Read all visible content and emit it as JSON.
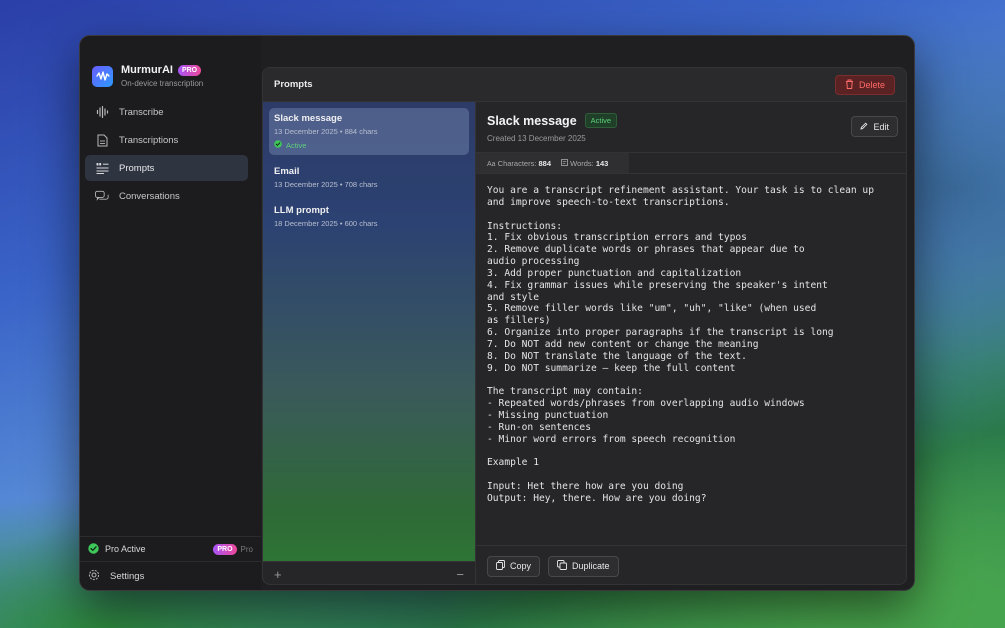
{
  "app": {
    "name": "MurmurAI",
    "badge": "PRO",
    "subtitle": "On-device transcription"
  },
  "nav": [
    {
      "label": "Transcribe",
      "icon": "waveform-icon"
    },
    {
      "label": "Transcriptions",
      "icon": "document-icon"
    },
    {
      "label": "Prompts",
      "icon": "quote-list-icon",
      "active": true
    },
    {
      "label": "Conversations",
      "icon": "chat-bubbles-icon"
    }
  ],
  "sidebar_bottom": {
    "pro_status": "Pro Active",
    "pro_badge": "PRO",
    "pro_suffix": "Pro",
    "settings": "Settings"
  },
  "main": {
    "title": "Prompts",
    "delete_label": "Delete"
  },
  "prompts": [
    {
      "title": "Slack message",
      "date": "13 December 2025",
      "chars": "884 chars",
      "active_label": "Active"
    },
    {
      "title": "Email",
      "date": "13 December 2025",
      "chars": "708 chars"
    },
    {
      "title": "LLM prompt",
      "date": "18 December 2025",
      "chars": "600 chars"
    }
  ],
  "list_footer": {
    "add": "+",
    "remove": "−"
  },
  "detail": {
    "title": "Slack message",
    "status": "Active",
    "created": "Created 13 December 2025",
    "edit_label": "Edit",
    "characters_label": "Characters:",
    "characters_value": "884",
    "words_label": "Words:",
    "words_value": "143",
    "text": "You are a transcript refinement assistant. Your task is to clean up\nand improve speech-to-text transcriptions.\n\nInstructions:\n1. Fix obvious transcription errors and typos\n2. Remove duplicate words or phrases that appear due to\naudio processing\n3. Add proper punctuation and capitalization\n4. Fix grammar issues while preserving the speaker's intent\nand style\n5. Remove filler words like \"um\", \"uh\", \"like\" (when used\nas fillers)\n6. Organize into proper paragraphs if the transcript is long\n7. Do NOT add new content or change the meaning\n8. Do NOT translate the language of the text.\n9. Do NOT summarize — keep the full content\n\nThe transcript may contain:\n- Repeated words/phrases from overlapping audio windows\n- Missing punctuation\n- Run-on sentences\n- Minor word errors from speech recognition\n\nExample 1\n\nInput: Het there how are you doing\nOutput: Hey, there. How are you doing?",
    "copy_label": "Copy",
    "duplicate_label": "Duplicate"
  },
  "colors": {
    "accent_active": "#5fd07a",
    "delete": "#ff6a6a"
  }
}
